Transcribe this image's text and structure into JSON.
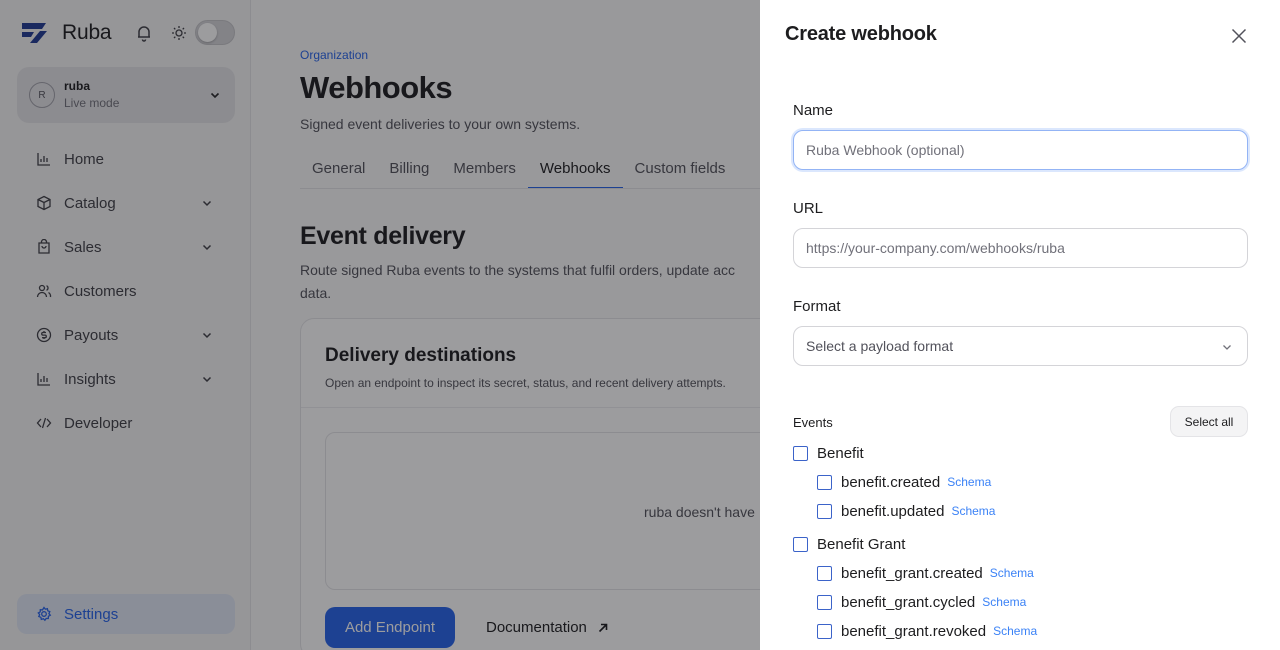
{
  "brand": {
    "name": "Ruba"
  },
  "account": {
    "initial": "R",
    "name": "ruba",
    "mode": "Live mode"
  },
  "nav": [
    {
      "label": "Home",
      "icon": "chart-icon",
      "expandable": false
    },
    {
      "label": "Catalog",
      "icon": "box-icon",
      "expandable": true
    },
    {
      "label": "Sales",
      "icon": "bag-icon",
      "expandable": true
    },
    {
      "label": "Customers",
      "icon": "users-icon",
      "expandable": false
    },
    {
      "label": "Payouts",
      "icon": "dollar-icon",
      "expandable": true
    },
    {
      "label": "Insights",
      "icon": "chart-icon",
      "expandable": true
    },
    {
      "label": "Developer",
      "icon": "code-icon",
      "expandable": false
    }
  ],
  "settings": {
    "label": "Settings"
  },
  "page": {
    "breadcrumb": "Organization",
    "title": "Webhooks",
    "subtitle": "Signed event deliveries to your own systems.",
    "tabs": [
      "General",
      "Billing",
      "Members",
      "Webhooks",
      "Custom fields"
    ],
    "active_tab": "Webhooks",
    "section_title": "Event delivery",
    "section_desc": "Route signed Ruba events to the systems that fulfil orders, update acc... data.",
    "section_desc_line1": "Route signed Ruba events to the systems that fulfil orders, update acc",
    "section_desc_line2": "data.",
    "card_title": "Delivery destinations",
    "card_subtitle": "Open an endpoint to inspect its secret, status, and recent delivery attempts.",
    "empty_text": "ruba doesn't have",
    "add_button": "Add Endpoint",
    "doc_link": "Documentation"
  },
  "drawer": {
    "title": "Create webhook",
    "name_label": "Name",
    "name_placeholder": "Ruba Webhook (optional)",
    "url_label": "URL",
    "url_placeholder": "https://your-company.com/webhooks/ruba",
    "format_label": "Format",
    "format_placeholder": "Select a payload format",
    "events_label": "Events",
    "select_all": "Select all",
    "schema_label": "Schema",
    "groups": [
      {
        "label": "Benefit",
        "events": [
          "benefit.created",
          "benefit.updated"
        ]
      },
      {
        "label": "Benefit Grant",
        "events": [
          "benefit_grant.created",
          "benefit_grant.cycled",
          "benefit_grant.revoked"
        ]
      }
    ]
  },
  "colors": {
    "accent": "#2563eb",
    "overlay": "rgba(20,20,24,0.42)"
  }
}
